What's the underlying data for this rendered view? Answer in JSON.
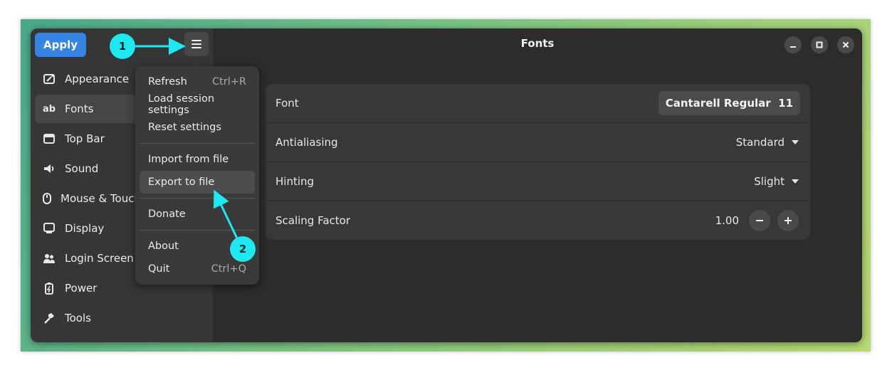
{
  "header": {
    "apply_label": "Apply",
    "title": "Fonts"
  },
  "sidebar": {
    "items": [
      {
        "label": "Appearance",
        "icon": "appearance-icon"
      },
      {
        "label": "Fonts",
        "icon": "fonts-icon",
        "icon_text": "ab"
      },
      {
        "label": "Top Bar",
        "icon": "top-bar-icon"
      },
      {
        "label": "Sound",
        "icon": "speaker-icon"
      },
      {
        "label": "Mouse & Touchpad",
        "icon": "mouse-icon"
      },
      {
        "label": "Display",
        "icon": "display-icon"
      },
      {
        "label": "Login Screen",
        "icon": "users-icon"
      },
      {
        "label": "Power",
        "icon": "battery-icon"
      },
      {
        "label": "Tools",
        "icon": "hammer-icon"
      }
    ]
  },
  "menu": {
    "items": [
      {
        "label": "Refresh",
        "shortcut": "Ctrl+R"
      },
      {
        "label": "Load session settings",
        "shortcut": ""
      },
      {
        "label": "Reset settings",
        "shortcut": ""
      },
      {
        "label": "Import from file",
        "shortcut": ""
      },
      {
        "label": "Export to file",
        "shortcut": ""
      },
      {
        "label": "Donate",
        "shortcut": ""
      },
      {
        "label": "About",
        "shortcut": ""
      },
      {
        "label": "Quit",
        "shortcut": "Ctrl+Q"
      }
    ]
  },
  "settings": {
    "font": {
      "label": "Font",
      "value": "Cantarell Regular  11"
    },
    "antialiasing": {
      "label": "Antialiasing",
      "value": "Standard"
    },
    "hinting": {
      "label": "Hinting",
      "value": "Slight"
    },
    "scaling": {
      "label": "Scaling Factor",
      "value": "1.00"
    }
  },
  "annotations": {
    "badge1": "1",
    "badge2": "2"
  },
  "colors": {
    "accent": "#3584e4",
    "annotation": "#1ee8f0"
  }
}
